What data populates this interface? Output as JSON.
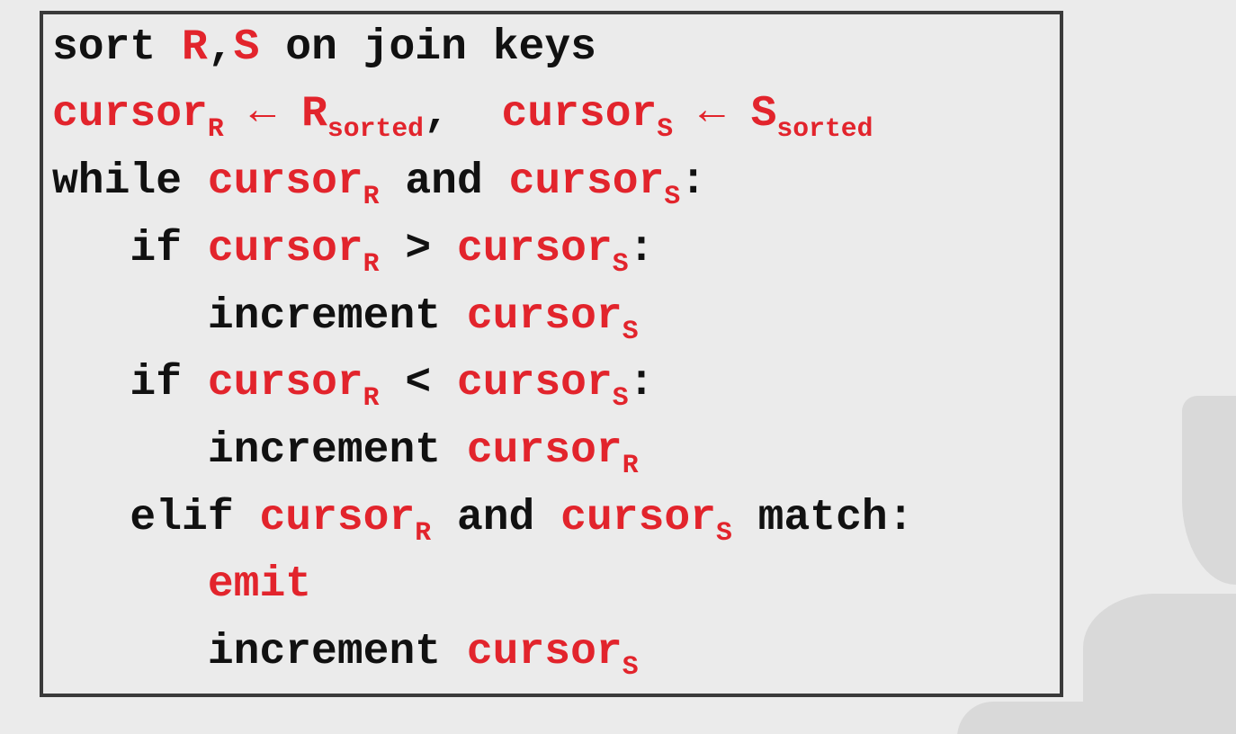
{
  "algo": {
    "line1": {
      "sort": "sort ",
      "R": "R",
      "comma": ",",
      "S": "S",
      "rest": " on join keys"
    },
    "line2": {
      "cursorR": "cursor",
      "subR1": "R",
      "arrow1": " ← ",
      "Rsorted_base": "R",
      "Rsorted_sub": "sorted",
      "sep": ",  ",
      "cursorS": "cursor",
      "subS1": "S",
      "arrow2": " ← ",
      "Ssorted_base": "S",
      "Ssorted_sub": "sorted"
    },
    "line3": {
      "while_kw": "while",
      "sp1": " ",
      "cursorR": "cursor",
      "subR": "R",
      "and_": " and ",
      "cursorS": "cursor",
      "subS": "S",
      "colon": ":"
    },
    "line4": {
      "indent": "   ",
      "if_kw": "if",
      "sp": " ",
      "cursorR": "cursor",
      "subR": "R",
      "gt": " > ",
      "cursorS": "cursor",
      "subS": "S",
      "colon": ":"
    },
    "line5": {
      "indent": "      ",
      "inc": "increment ",
      "cursorS": "cursor",
      "subS": "S"
    },
    "line6": {
      "indent": "   ",
      "if_kw": "if",
      "sp": " ",
      "cursorR": "cursor",
      "subR": "R",
      "lt": " < ",
      "cursorS": "cursor",
      "subS": "S",
      "colon": ":"
    },
    "line7": {
      "indent": "      ",
      "inc": "increment ",
      "cursorR": "cursor",
      "subR": "R"
    },
    "line8": {
      "indent": "   ",
      "elif_kw": "elif",
      "sp": " ",
      "cursorR": "cursor",
      "subR": "R",
      "and_": " and ",
      "cursorS": "cursor",
      "subS": "S",
      "match": " match:"
    },
    "line9": {
      "indent": "      ",
      "emit": "emit"
    },
    "line10": {
      "indent": "      ",
      "inc": "increment ",
      "cursorS": "cursor",
      "subS": "S"
    }
  }
}
